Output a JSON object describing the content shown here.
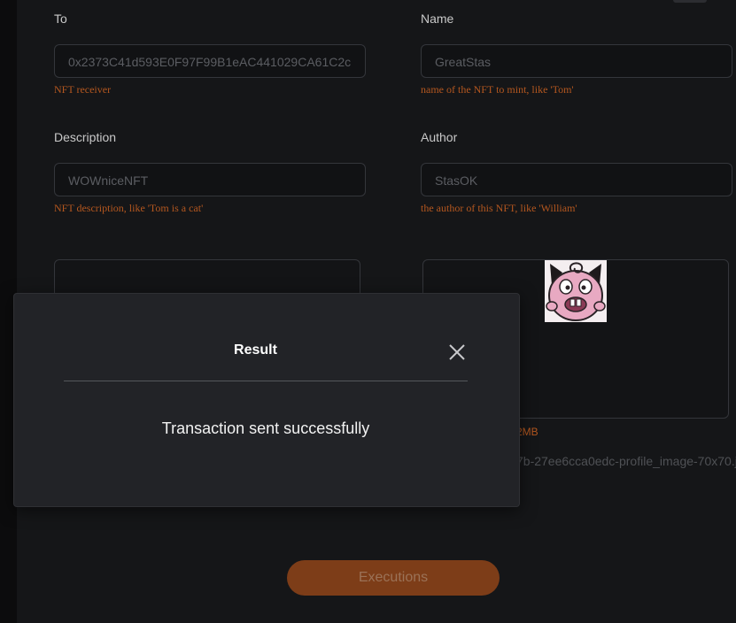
{
  "form": {
    "to": {
      "label": "To",
      "value": "0x2373C41d593E0F97F99B1eAC441029CA61C2c",
      "hint": "NFT receiver"
    },
    "name": {
      "label": "Name",
      "value": "GreatStas",
      "hint": "name of the NFT to mint, like 'Tom'"
    },
    "description": {
      "label": "Description",
      "value": "WOWniceNFT",
      "hint": "NFT description, like 'Tom is a cat'"
    },
    "author": {
      "label": "Author",
      "value": "StasOK",
      "hint": "the author of this NFT, like 'William'"
    }
  },
  "upload": {
    "size_note": "2MB",
    "file_name": "7b-27ee6cca0edc-profile_image-70x70.j",
    "thumbnail_icon": "pink-creature-image"
  },
  "actions": {
    "execute_label": "Executions"
  },
  "modal": {
    "title": "Result",
    "message": "Transaction sent successfully",
    "close_icon": "close-icon"
  },
  "colors": {
    "background": "#151618",
    "hint": "#b4571f",
    "button": "#7d3d18",
    "modal": "#222327"
  }
}
